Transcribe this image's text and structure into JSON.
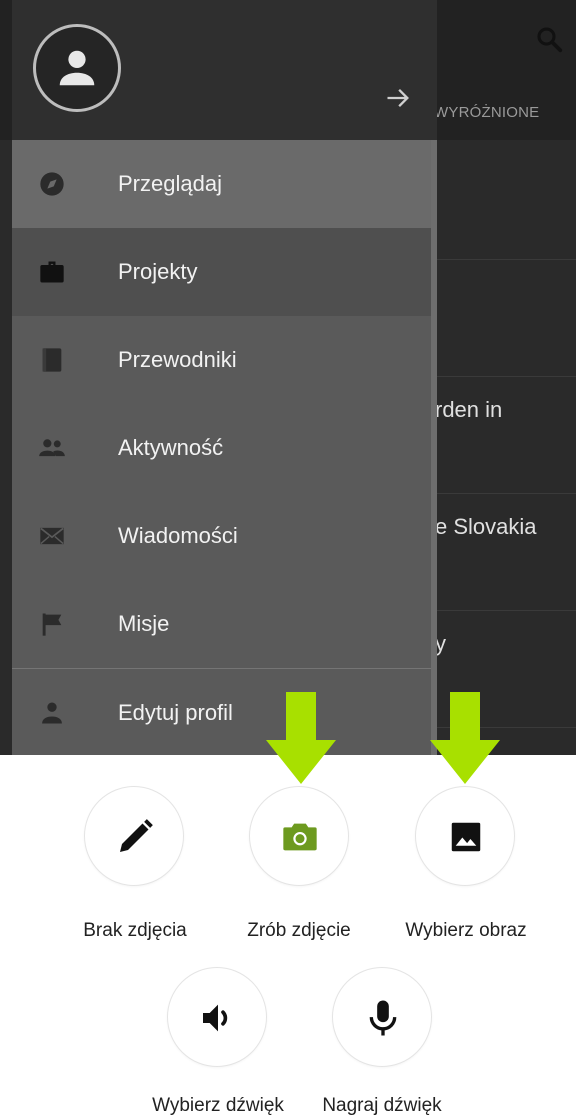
{
  "background_screen": {
    "tab_label": "WYRÓŻNIONE",
    "rows": [
      "",
      "",
      "",
      "rden in",
      "e Slovakia",
      "y"
    ]
  },
  "drawer": {
    "menu": [
      {
        "label": "Przeglądaj",
        "icon": "compass-icon"
      },
      {
        "label": "Projekty",
        "icon": "briefcase-icon"
      },
      {
        "label": "Przewodniki",
        "icon": "book-icon"
      },
      {
        "label": "Aktywność",
        "icon": "people-icon"
      },
      {
        "label": "Wiadomości",
        "icon": "envelope-icon"
      },
      {
        "label": "Misje",
        "icon": "flag-icon"
      },
      {
        "label": "Edytuj profil",
        "icon": "person-icon"
      }
    ]
  },
  "actions": [
    {
      "label": "Brak zdjęcia",
      "icon": "pencil-icon"
    },
    {
      "label": "Zrób zdjęcie",
      "icon": "camera-icon"
    },
    {
      "label": "Wybierz obraz",
      "icon": "image-icon"
    },
    {
      "label": "Wybierz dźwięk",
      "icon": "speaker-icon"
    },
    {
      "label": "Nagraj dźwięk",
      "icon": "microphone-icon"
    }
  ],
  "colors": {
    "accent_green": "#6d9a1f",
    "indicator_arrow": "#a8e000"
  }
}
